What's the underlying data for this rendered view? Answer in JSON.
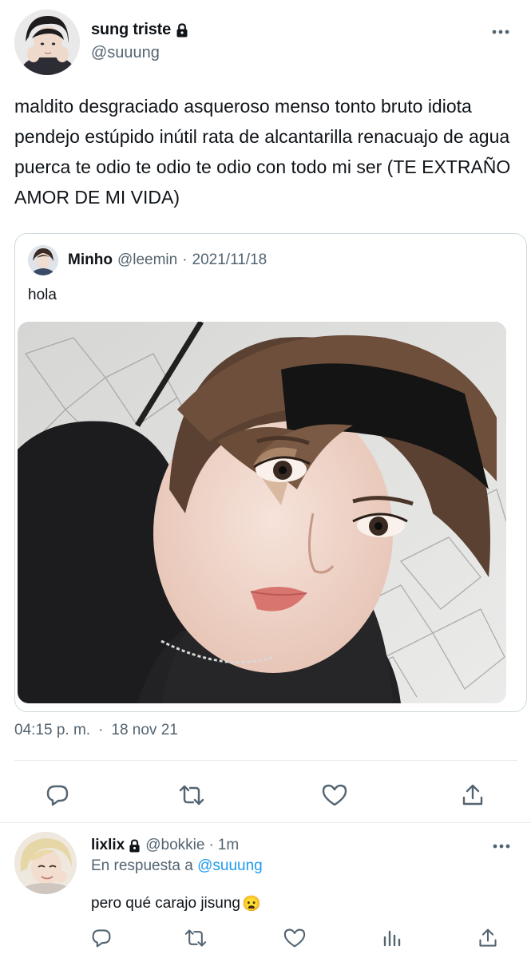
{
  "tweet": {
    "author_name": "sung triste",
    "author_handle": "@suuung",
    "text": "maldito desgraciado asqueroso menso tonto bruto idiota pendejo estúpido inútil rata de alcantarilla renacuajo de agua puerca te odio te odio te odio con todo mi ser (TE EXTRAÑO AMOR DE MI VIDA)",
    "time": "04:15 p. m.",
    "separator": "·",
    "date": "18 nov 21"
  },
  "quote": {
    "author_name": "Minho",
    "author_handle": "@leemin",
    "separator": "·",
    "date": "2021/11/18",
    "text": "hola"
  },
  "actions": [
    "reply-icon",
    "retweet-icon",
    "like-icon",
    "share-icon"
  ],
  "reply": {
    "author_name": "lixlix",
    "author_handle": "@bokkie",
    "separator": "·",
    "time": "1m",
    "reply_to_prefix": "En respuesta a",
    "reply_to_handle": "@suuung",
    "text": "pero qué carajo jisung",
    "emoji": "😦",
    "actions": [
      "reply-icon",
      "retweet-icon",
      "like-icon",
      "analytics-icon",
      "share-icon"
    ]
  },
  "colors": {
    "text_primary": "#0f1419",
    "text_secondary": "#536471",
    "link": "#1d9bf0",
    "border": "#cfd9de"
  }
}
